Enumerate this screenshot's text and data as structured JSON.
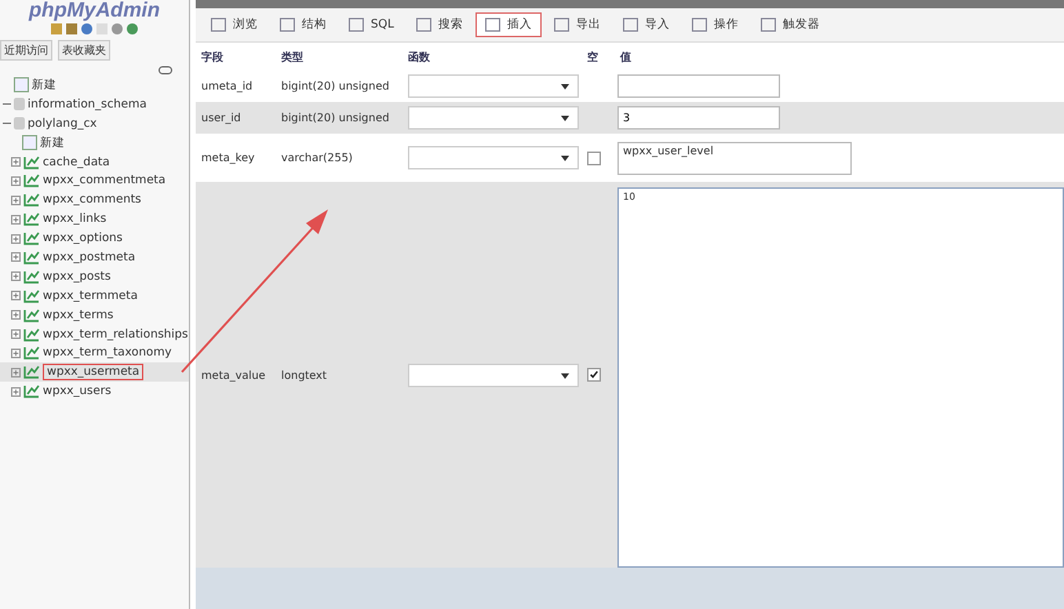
{
  "logo": "phpMyAdmin",
  "sidebar": {
    "tabs": [
      {
        "label": "近期访问",
        "selected": false
      },
      {
        "label": "表收藏夹",
        "selected": false
      }
    ],
    "tree": [
      {
        "label": "新建",
        "kind": "new",
        "selected": false
      },
      {
        "label": "information_schema",
        "kind": "db",
        "selected": false
      },
      {
        "label": "polylang_cx",
        "kind": "db",
        "selected": false,
        "children": [
          {
            "label": "新建",
            "kind": "new",
            "selected": false
          },
          {
            "label": "cache_data",
            "kind": "table",
            "selected": false
          },
          {
            "label": "wpxx_commentmeta",
            "kind": "table",
            "selected": false
          },
          {
            "label": "wpxx_comments",
            "kind": "table",
            "selected": false
          },
          {
            "label": "wpxx_links",
            "kind": "table",
            "selected": false
          },
          {
            "label": "wpxx_options",
            "kind": "table",
            "selected": false
          },
          {
            "label": "wpxx_postmeta",
            "kind": "table",
            "selected": false
          },
          {
            "label": "wpxx_posts",
            "kind": "table",
            "selected": false
          },
          {
            "label": "wpxx_termmeta",
            "kind": "table",
            "selected": false
          },
          {
            "label": "wpxx_terms",
            "kind": "table",
            "selected": false
          },
          {
            "label": "wpxx_term_relationships",
            "kind": "table",
            "selected": false
          },
          {
            "label": "wpxx_term_taxonomy",
            "kind": "table",
            "selected": false
          },
          {
            "label": "wpxx_usermeta",
            "kind": "table",
            "selected": true
          },
          {
            "label": "wpxx_users",
            "kind": "table",
            "selected": false
          }
        ]
      }
    ]
  },
  "tabs": [
    {
      "label": "浏览",
      "selected": false
    },
    {
      "label": "结构",
      "selected": false
    },
    {
      "label": "SQL",
      "selected": false
    },
    {
      "label": "搜索",
      "selected": false
    },
    {
      "label": "插入",
      "selected": true
    },
    {
      "label": "导出",
      "selected": false
    },
    {
      "label": "导入",
      "selected": false
    },
    {
      "label": "操作",
      "selected": false
    },
    {
      "label": "触发器",
      "selected": false
    }
  ],
  "table": {
    "columns": [
      "字段",
      "类型",
      "函数",
      "空",
      "值"
    ],
    "rows": [
      {
        "field": "umeta_id",
        "type": "bigint(20) unsigned",
        "kind": "input",
        "value": ""
      },
      {
        "field": "user_id",
        "type": "bigint(20) unsigned",
        "kind": "input",
        "value": "3"
      },
      {
        "field": "meta_key",
        "type": "varchar(255)",
        "kind": "textarea",
        "null": false,
        "value": "wpxx_user_level"
      },
      {
        "field": "meta_value",
        "type": "longtext",
        "kind": "bigtext",
        "null": true,
        "value": "10"
      }
    ]
  }
}
